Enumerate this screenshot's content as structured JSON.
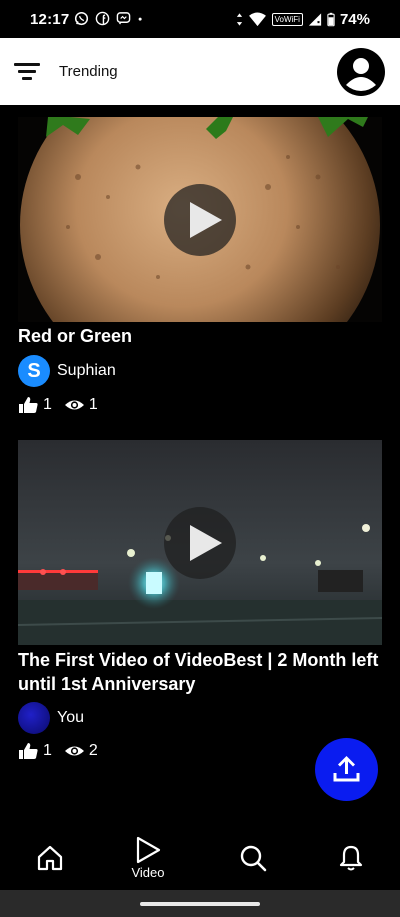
{
  "status_bar": {
    "time": "12:17",
    "notification_icons": [
      "whatsapp-icon",
      "facebook-icon",
      "messenger-icon",
      "dot-icon"
    ],
    "network_label": "VoWiFi",
    "battery": "74%"
  },
  "header": {
    "title": "Trending"
  },
  "videos": [
    {
      "title": "Red or Green",
      "channel": "Suphian",
      "channel_initial": "S",
      "channel_avatar_color": "#1a8cff",
      "likes": "1",
      "views": "1"
    },
    {
      "title": "The First Video of VideoBest | 2 Month left until 1st Anniversary",
      "channel": "You",
      "channel_initial": "",
      "channel_avatar_color": "#1010a0",
      "likes": "1",
      "views": "2"
    }
  ],
  "fab": {
    "icon": "upload-icon",
    "color": "#0a1cf0"
  },
  "bottom_nav": {
    "items": [
      {
        "icon": "home-icon",
        "label": ""
      },
      {
        "icon": "video-play-icon",
        "label": "Video"
      },
      {
        "icon": "search-icon",
        "label": ""
      },
      {
        "icon": "bell-icon",
        "label": ""
      }
    ],
    "active_index": 1
  }
}
